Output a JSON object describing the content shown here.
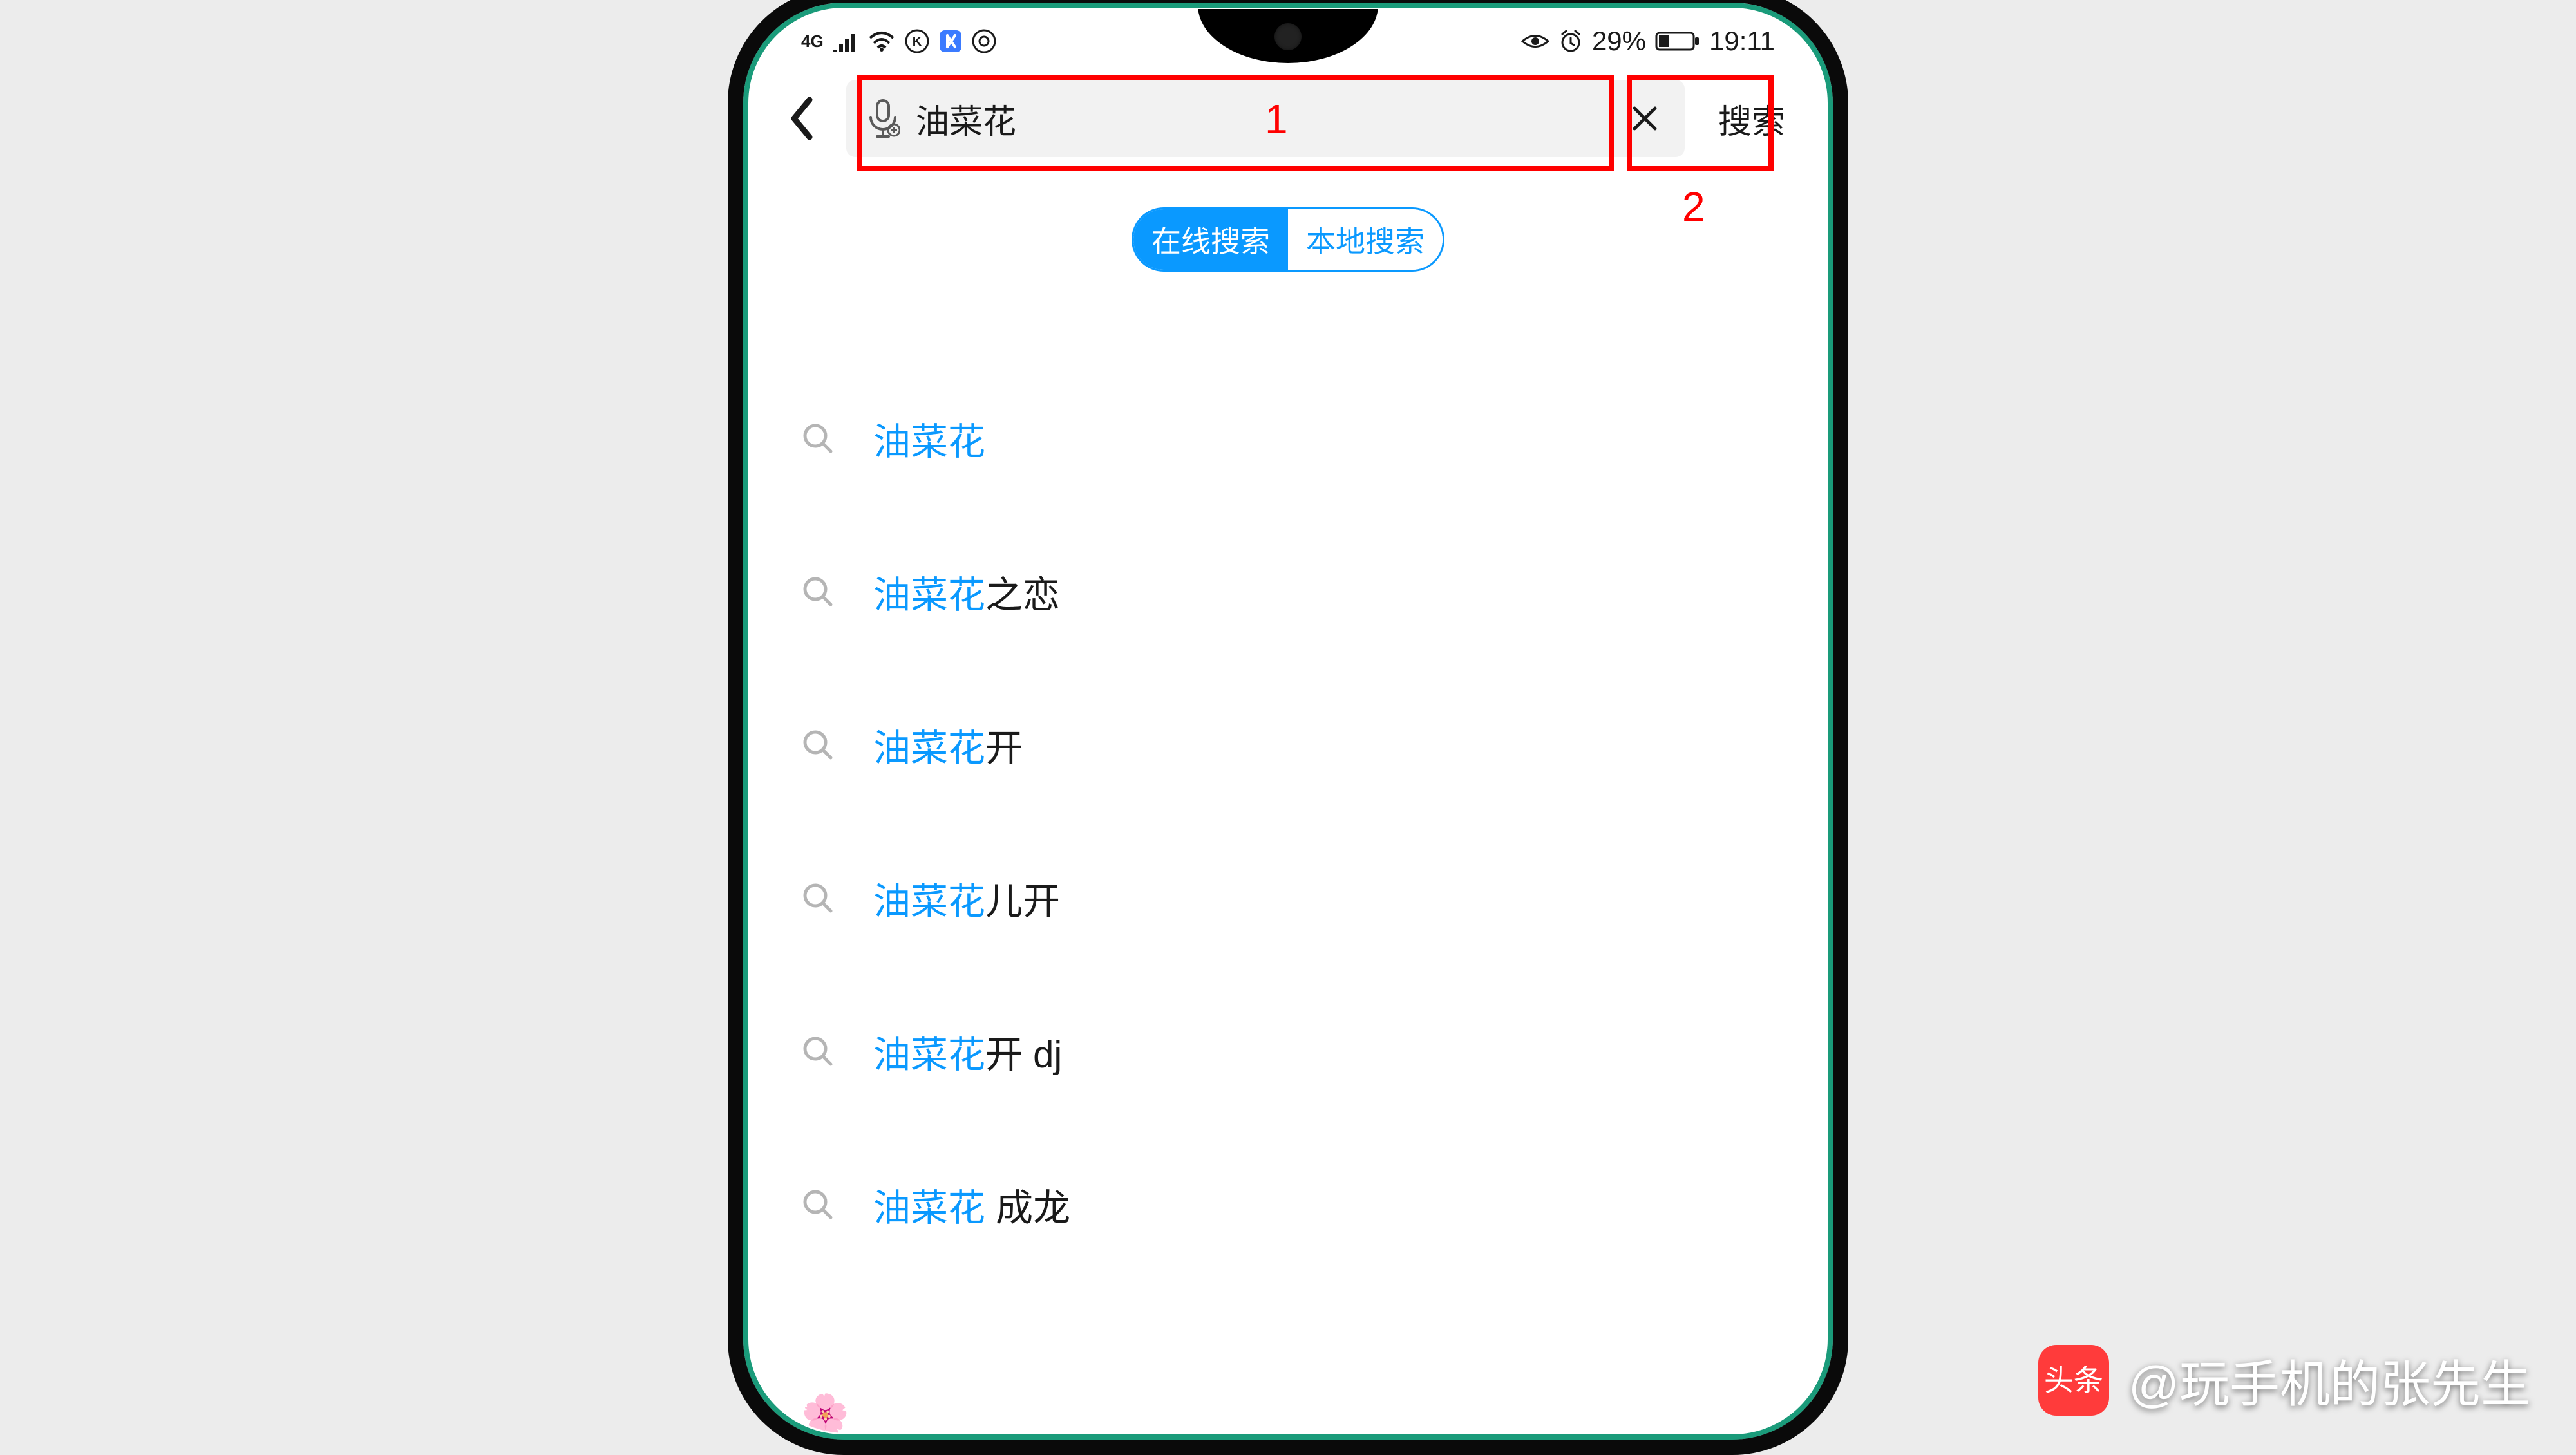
{
  "status": {
    "network": "4G",
    "battery_pct": "29%",
    "time": "19:11"
  },
  "nav": {
    "search_value": "油菜花",
    "search_button": "搜索"
  },
  "annotations": {
    "label_1": "1",
    "label_2": "2"
  },
  "tabs": {
    "online": "在线搜索",
    "local": "本地搜索"
  },
  "suggestions": [
    {
      "highlight": "油菜花",
      "rest": ""
    },
    {
      "highlight": "油菜花",
      "rest": "之恋"
    },
    {
      "highlight": "油菜花",
      "rest": "开"
    },
    {
      "highlight": "油菜花",
      "rest": "儿开"
    },
    {
      "highlight": "油菜花",
      "rest": "开 dj"
    },
    {
      "highlight": "油菜花",
      "rest": " 成龙"
    }
  ],
  "watermark": {
    "badge": "头条",
    "handle": "@玩手机的张先生"
  }
}
